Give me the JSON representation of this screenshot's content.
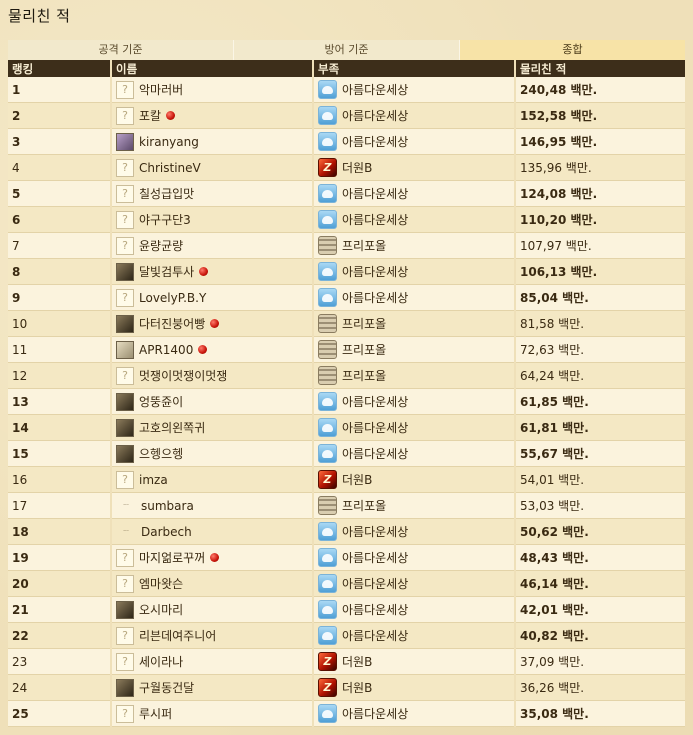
{
  "page": {
    "title": "물리친 적"
  },
  "tabs": [
    {
      "label": "공격 기준",
      "active": false
    },
    {
      "label": "방어 기준",
      "active": false
    },
    {
      "label": "종합",
      "active": true
    }
  ],
  "columns": {
    "rank": "랭킹",
    "name": "이름",
    "faction": "부족",
    "defeated": "물리친 적"
  },
  "icons": {
    "realm_angel": "angel-realm-icon",
    "realm_dark": "dark-realm-icon",
    "realm_free": "free-realm-icon",
    "online": "red-dot-icon",
    "avatar_default": "question-mark-icon"
  },
  "colors": {
    "header_bg": "#3d2e1a",
    "active_tab": "#f7e3a7",
    "row_odd": "#fbf3dd",
    "row_even": "#f4e8c4"
  },
  "rows": [
    {
      "rank": "1",
      "name": "악마러버",
      "faction": "아름다운세상",
      "realm": "angel",
      "defeated": "240,48 백만.",
      "bold": true,
      "avatar": "?",
      "dot": false
    },
    {
      "rank": "2",
      "name": "포칼",
      "faction": "아름다운세상",
      "realm": "angel",
      "defeated": "152,58 백만.",
      "bold": true,
      "avatar": "?",
      "dot": true
    },
    {
      "rank": "3",
      "name": "kiranyang",
      "faction": "아름다운세상",
      "realm": "angel",
      "defeated": "146,95 백만.",
      "bold": true,
      "avatar": "purple",
      "dot": false
    },
    {
      "rank": "4",
      "name": "ChristineV",
      "faction": "더원B",
      "realm": "dark",
      "defeated": "135,96 백만.",
      "bold": false,
      "avatar": "?",
      "dot": false
    },
    {
      "rank": "5",
      "name": "칠성급입맛",
      "faction": "아름다운세상",
      "realm": "angel",
      "defeated": "124,08 백만.",
      "bold": true,
      "avatar": "?",
      "dot": false
    },
    {
      "rank": "6",
      "name": "야구구단3",
      "faction": "아름다운세상",
      "realm": "angel",
      "defeated": "110,20 백만.",
      "bold": true,
      "avatar": "?",
      "dot": false
    },
    {
      "rank": "7",
      "name": "윤량균량",
      "faction": "프리포올",
      "realm": "free",
      "defeated": "107,97 백만.",
      "bold": false,
      "avatar": "?",
      "dot": false
    },
    {
      "rank": "8",
      "name": "달빛검투사",
      "faction": "아름다운세상",
      "realm": "angel",
      "defeated": "106,13 백만.",
      "bold": true,
      "avatar": "photo",
      "dot": true
    },
    {
      "rank": "9",
      "name": "LovelyP.B.Y",
      "faction": "아름다운세상",
      "realm": "angel",
      "defeated": "85,04 백만.",
      "bold": true,
      "avatar": "?",
      "dot": false
    },
    {
      "rank": "10",
      "name": "다터진붕어빵",
      "faction": "프리포올",
      "realm": "free",
      "defeated": "81,58 백만.",
      "bold": false,
      "avatar": "photo",
      "dot": true
    },
    {
      "rank": "11",
      "name": "APR1400",
      "faction": "프리포올",
      "realm": "free",
      "defeated": "72,63 백만.",
      "bold": false,
      "avatar": "light",
      "dot": true
    },
    {
      "rank": "12",
      "name": "멋쟁이멋쟁이멋쟁",
      "faction": "프리포올",
      "realm": "free",
      "defeated": "64,24 백만.",
      "bold": false,
      "avatar": "?",
      "dot": false
    },
    {
      "rank": "13",
      "name": "엉뚱쥰이",
      "faction": "아름다운세상",
      "realm": "angel",
      "defeated": "61,85 백만.",
      "bold": true,
      "avatar": "photo",
      "dot": false
    },
    {
      "rank": "14",
      "name": "고호의왼쪽귀",
      "faction": "아름다운세상",
      "realm": "angel",
      "defeated": "61,81 백만.",
      "bold": true,
      "avatar": "photo",
      "dot": false
    },
    {
      "rank": "15",
      "name": "으헹으헹",
      "faction": "아름다운세상",
      "realm": "angel",
      "defeated": "55,67 백만.",
      "bold": true,
      "avatar": "photo",
      "dot": false
    },
    {
      "rank": "16",
      "name": "imza",
      "faction": "더원B",
      "realm": "dark",
      "defeated": "54,01 백만.",
      "bold": false,
      "avatar": "?",
      "dot": false
    },
    {
      "rank": "17",
      "name": "sumbara",
      "faction": "프리포올",
      "realm": "free",
      "defeated": "53,03 백만.",
      "bold": false,
      "avatar": "text",
      "dot": false
    },
    {
      "rank": "18",
      "name": "Darbech",
      "faction": "아름다운세상",
      "realm": "angel",
      "defeated": "50,62 백만.",
      "bold": true,
      "avatar": "text",
      "dot": false
    },
    {
      "rank": "19",
      "name": "마지얾로꾸꺼",
      "faction": "아름다운세상",
      "realm": "angel",
      "defeated": "48,43 백만.",
      "bold": true,
      "avatar": "?",
      "dot": true
    },
    {
      "rank": "20",
      "name": "엠마왓슨",
      "faction": "아름다운세상",
      "realm": "angel",
      "defeated": "46,14 백만.",
      "bold": true,
      "avatar": "?",
      "dot": false
    },
    {
      "rank": "21",
      "name": "오시마리",
      "faction": "아름다운세상",
      "realm": "angel",
      "defeated": "42,01 백만.",
      "bold": true,
      "avatar": "photo",
      "dot": false
    },
    {
      "rank": "22",
      "name": "리븐데여주니어",
      "faction": "아름다운세상",
      "realm": "angel",
      "defeated": "40,82 백만.",
      "bold": true,
      "avatar": "?",
      "dot": false
    },
    {
      "rank": "23",
      "name": "세이라나",
      "faction": "더원B",
      "realm": "dark",
      "defeated": "37,09 백만.",
      "bold": false,
      "avatar": "?",
      "dot": false
    },
    {
      "rank": "24",
      "name": "구월동건달",
      "faction": "더원B",
      "realm": "dark",
      "defeated": "36,26 백만.",
      "bold": false,
      "avatar": "photo",
      "dot": false
    },
    {
      "rank": "25",
      "name": "루시퍼",
      "faction": "아름다운세상",
      "realm": "angel",
      "defeated": "35,08 백만.",
      "bold": true,
      "avatar": "?",
      "dot": false
    }
  ]
}
